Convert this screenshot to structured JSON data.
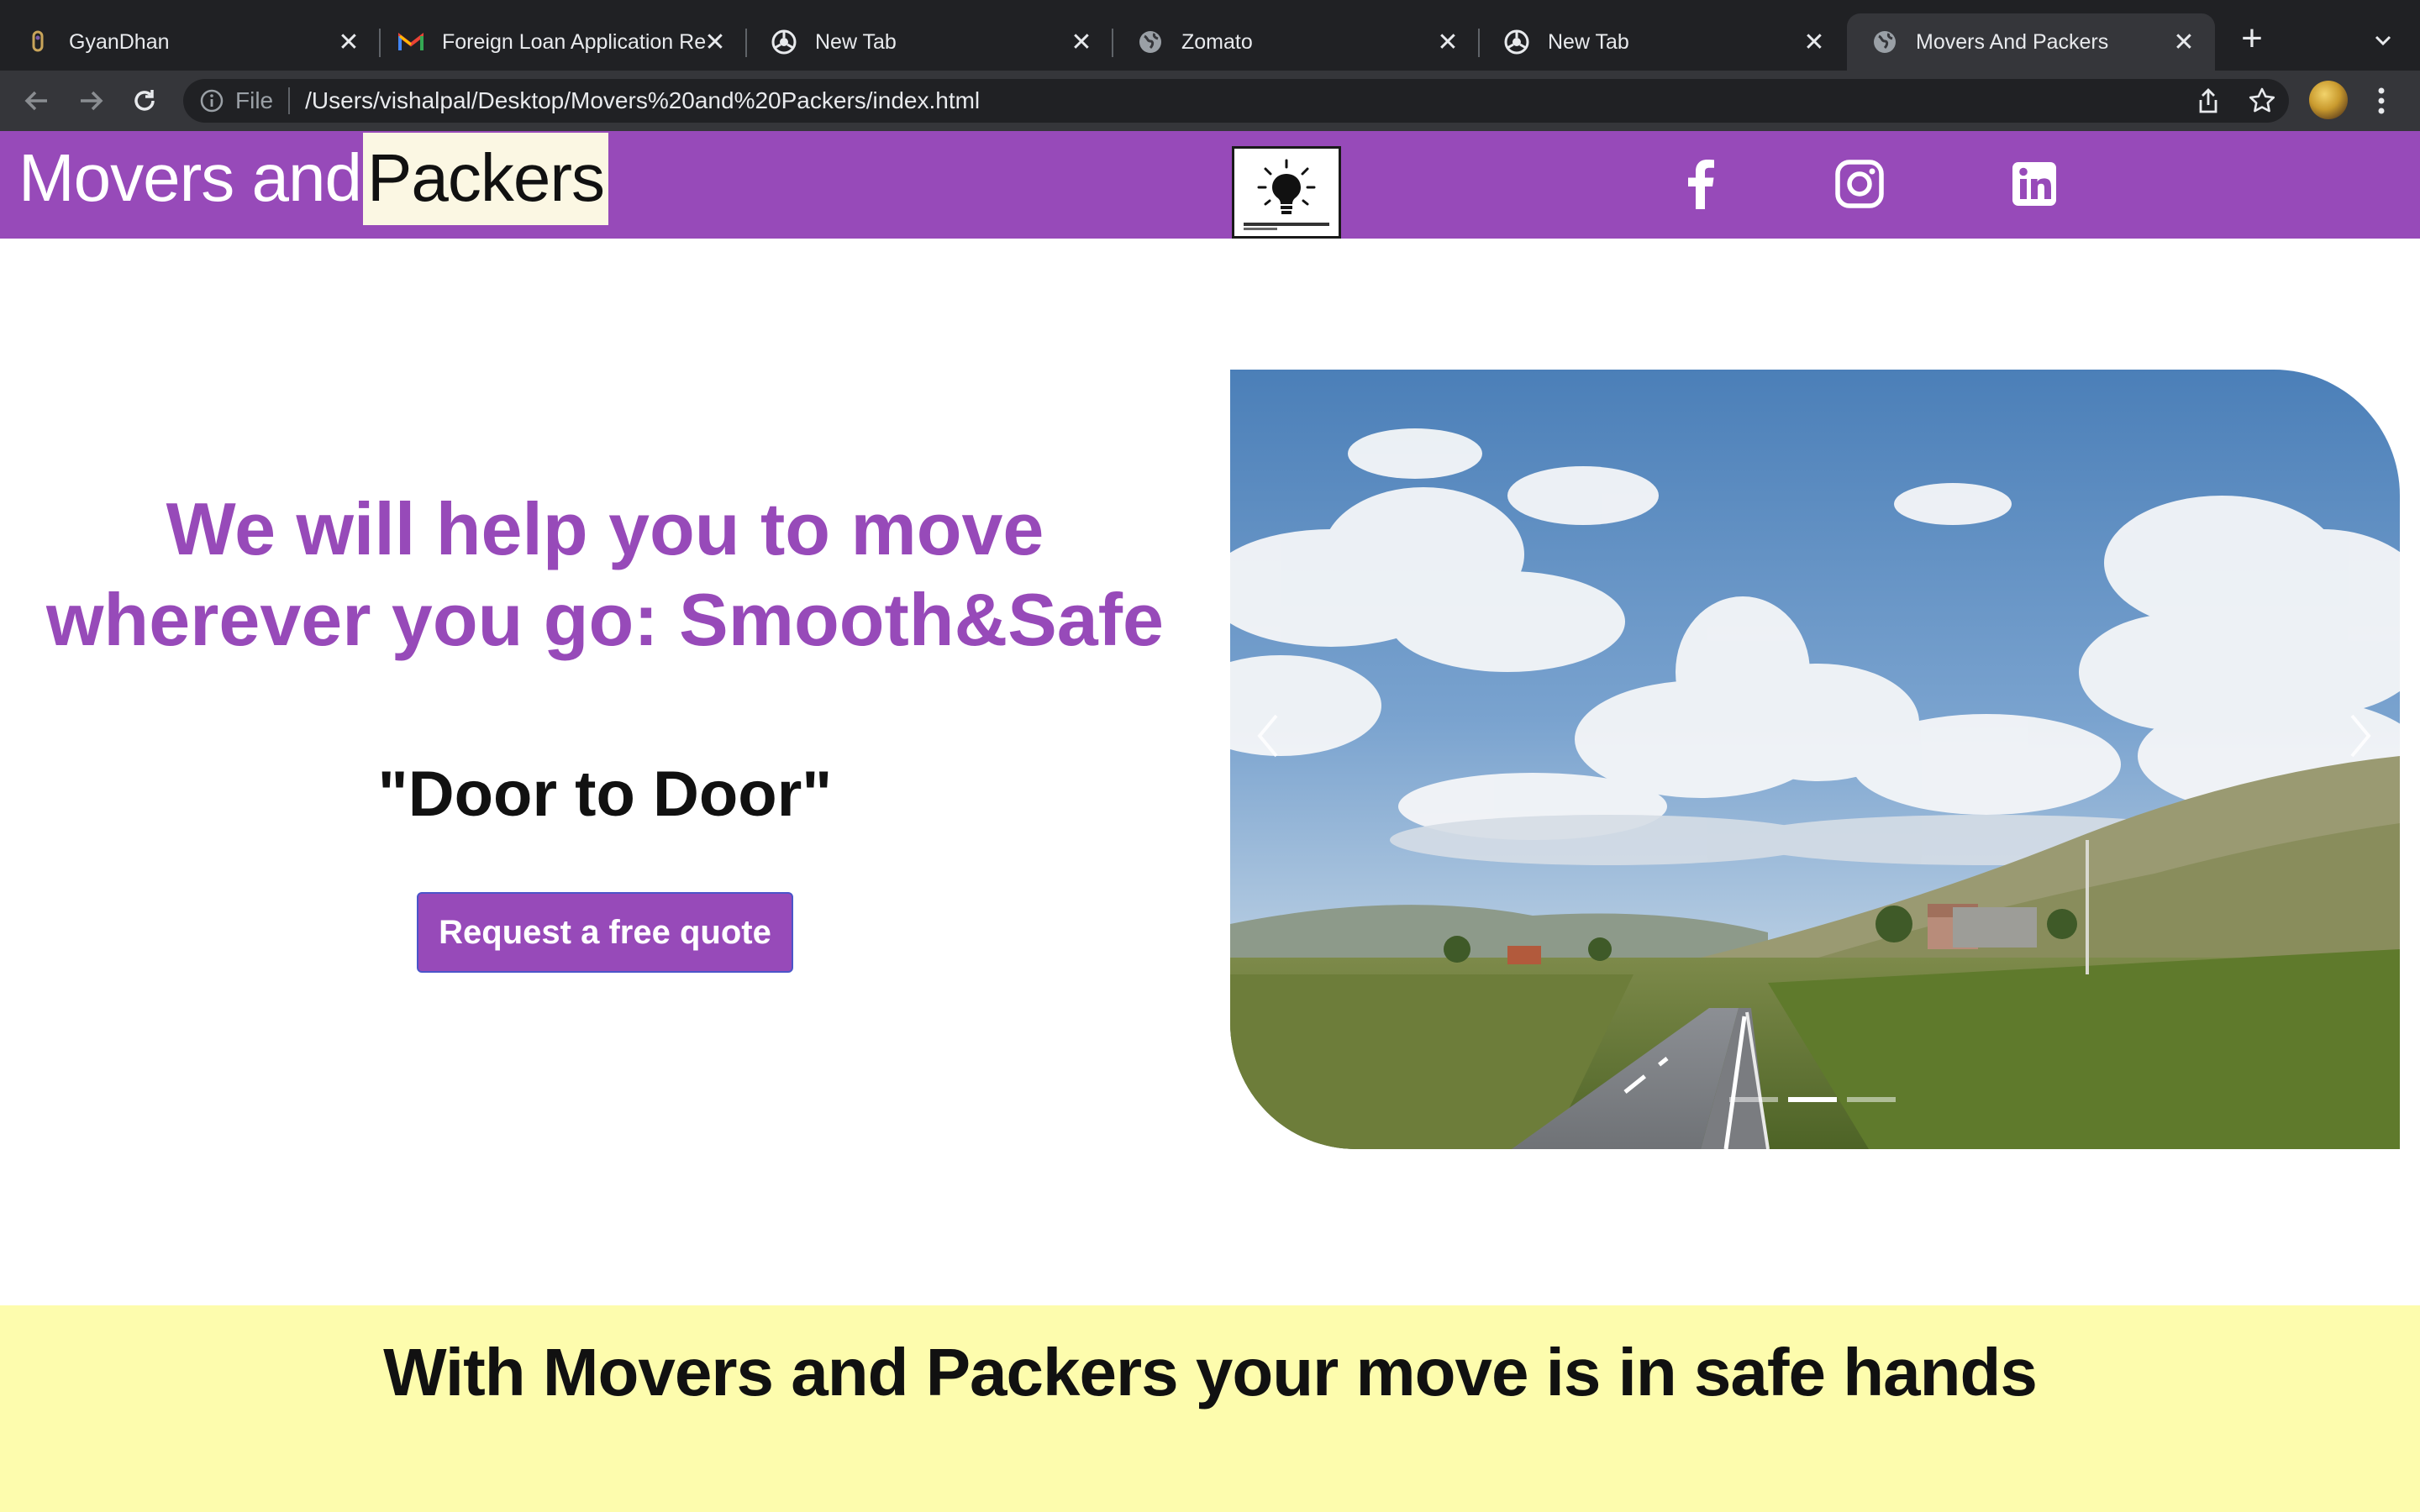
{
  "browser": {
    "tabs": [
      {
        "title": "GyanDhan",
        "favicon": "gyandhan-icon",
        "active": false
      },
      {
        "title": "Foreign Loan Application Re",
        "favicon": "gmail-icon",
        "active": false
      },
      {
        "title": "New Tab",
        "favicon": "chrome-icon",
        "active": false
      },
      {
        "title": "Zomato",
        "favicon": "globe-icon",
        "active": false
      },
      {
        "title": "New Tab",
        "favicon": "chrome-icon",
        "active": false
      },
      {
        "title": "Movers And Packers",
        "favicon": "globe-icon",
        "active": true
      }
    ],
    "omnibox": {
      "scheme_label": "File",
      "url": "/Users/vishalpal/Desktop/Movers%20and%20Packers/index.html"
    }
  },
  "page": {
    "navbar": {
      "brand_part1": "Movers and",
      "brand_part2": "Packers",
      "logo_icon": "lightbulb-icon",
      "social": [
        "facebook-icon",
        "instagram-icon",
        "linkedin-icon"
      ]
    },
    "hero": {
      "heading": "We will help you to move wherever you go: Smooth&Safe",
      "subheading": "\"Door to Door\"",
      "cta_label": "Request a free quote"
    },
    "carousel": {
      "slide_count": 3,
      "active_index": 1
    },
    "footer": {
      "tagline": "With Movers and Packers your move is in safe hands"
    }
  },
  "colors": {
    "brand_purple": "#974ab9",
    "brand_highlight": "#fbf7e3",
    "footer_yellow": "#fdfcad",
    "chrome_dark": "#202124",
    "chrome_toolbar": "#35363a"
  }
}
